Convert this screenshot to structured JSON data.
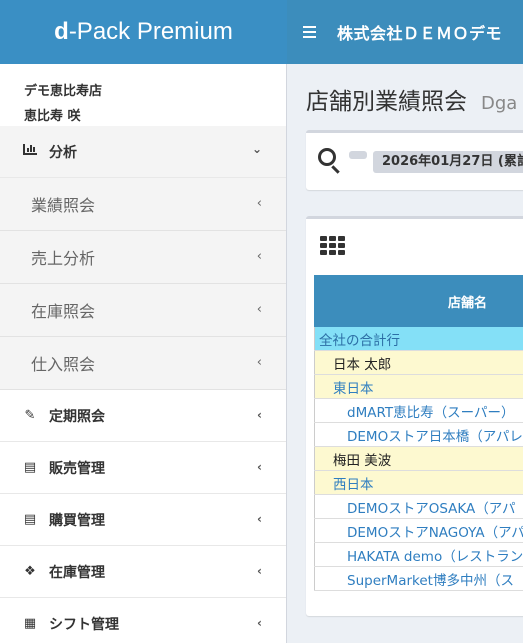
{
  "header": {
    "brand_bold": "d",
    "brand_rest": "-Pack Premium",
    "company": "株式会社ＤＥＭＯデモ"
  },
  "user": {
    "store": "デモ恵比寿店",
    "name": "恵比寿 咲"
  },
  "sidebar": {
    "analysis_label": "分析",
    "analysis_sub": [
      "業績照会",
      "売上分析",
      "在庫照会",
      "仕入照会"
    ],
    "items": [
      {
        "label": "定期照会",
        "icon": "edit-icon"
      },
      {
        "label": "販売管理",
        "icon": "register-icon"
      },
      {
        "label": "購買管理",
        "icon": "document-icon"
      },
      {
        "label": "在庫管理",
        "icon": "cubes-icon"
      },
      {
        "label": "シフト管理",
        "icon": "calendar-icon"
      }
    ]
  },
  "main": {
    "title": "店舗別業績照会",
    "subtitle": "Dga",
    "date_badge": "2026年01月27日 (累計",
    "table_header": "店舗名",
    "rows": [
      {
        "type": "total",
        "label": "全社の合計行"
      },
      {
        "type": "person",
        "label": "日本 太郎"
      },
      {
        "type": "region",
        "label": "東日本"
      },
      {
        "type": "store",
        "label": "dMART恵比寿（スーパー）"
      },
      {
        "type": "store",
        "label": "DEMOストア日本橋（アパレ"
      },
      {
        "type": "person",
        "label": "梅田 美波"
      },
      {
        "type": "region",
        "label": "西日本"
      },
      {
        "type": "store",
        "label": "DEMOストアOSAKA（アパ"
      },
      {
        "type": "store",
        "label": "DEMOストアNAGOYA（アパ"
      },
      {
        "type": "store",
        "label": "HAKATA demo（レストラン"
      },
      {
        "type": "store",
        "label": "SuperMarket博多中州（ス"
      }
    ]
  }
}
